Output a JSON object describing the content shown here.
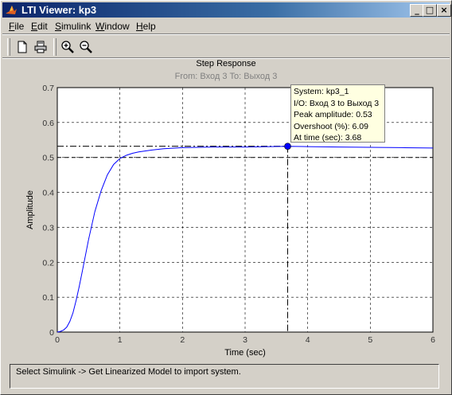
{
  "window": {
    "title": "LTI Viewer: kp3",
    "controls": {
      "minimize": "_",
      "maximize": "□",
      "close": "×"
    }
  },
  "menu": [
    {
      "label": "File",
      "key": "F",
      "rest": "ile"
    },
    {
      "label": "Edit",
      "key": "E",
      "rest": "dit"
    },
    {
      "label": "Simulink",
      "key": "S",
      "rest": "imulink"
    },
    {
      "label": "Window",
      "key": "W",
      "rest": "indow"
    },
    {
      "label": "Help",
      "key": "H",
      "rest": "elp"
    }
  ],
  "toolbar": {
    "icons": [
      "new-document-icon",
      "print-icon",
      "zoom-in-icon",
      "zoom-out-icon"
    ]
  },
  "plot": {
    "title": "Step Response",
    "subtitle": "From: Вход 3  To: Выход 3",
    "xlabel": "Time (sec)",
    "ylabel": "Amplitude"
  },
  "tooltip": {
    "system": "System: kp3_1",
    "io": "I/O: Вход 3 to Выход 3",
    "peak": "Peak amplitude: 0.53",
    "overshoot": "Overshoot (%): 6.09",
    "time": "At time (sec): 3.68"
  },
  "status": {
    "message": "Select Simulink -> Get Linearized Model to import system."
  },
  "colors": {
    "titlebar_start": "#0a246a",
    "response_line": "#0000ff",
    "tooltip_bg": "#ffffe1",
    "window_bg": "#d4d0c8"
  },
  "chart_data": {
    "type": "line",
    "title": "Step Response",
    "subtitle": "From: Вход 3  To: Выход 3",
    "xlabel": "Time (sec)",
    "ylabel": "Amplitude",
    "xlim": [
      0,
      6
    ],
    "ylim": [
      0,
      0.7
    ],
    "xticks": [
      0,
      1,
      2,
      3,
      4,
      5,
      6
    ],
    "yticks": [
      0,
      0.1,
      0.2,
      0.3,
      0.4,
      0.5,
      0.6,
      0.7
    ],
    "grid": true,
    "series": [
      {
        "x": [
          0,
          0.05,
          0.1,
          0.15,
          0.2,
          0.25,
          0.3,
          0.35,
          0.4,
          0.5,
          0.6,
          0.7,
          0.8,
          0.9,
          1.0,
          1.1,
          1.2,
          1.3,
          1.5,
          1.7,
          2.0,
          2.5,
          3.0,
          3.68,
          4.0,
          4.5,
          5.0,
          5.5,
          6.0
        ],
        "y": [
          0,
          0.002,
          0.006,
          0.014,
          0.03,
          0.055,
          0.09,
          0.13,
          0.175,
          0.265,
          0.345,
          0.405,
          0.45,
          0.48,
          0.497,
          0.506,
          0.512,
          0.516,
          0.521,
          0.525,
          0.528,
          0.53,
          0.53,
          0.532,
          0.531,
          0.53,
          0.529,
          0.528,
          0.527
        ]
      }
    ],
    "steady_state": 0.5,
    "peak": {
      "x": 3.68,
      "y": 0.532
    }
  }
}
